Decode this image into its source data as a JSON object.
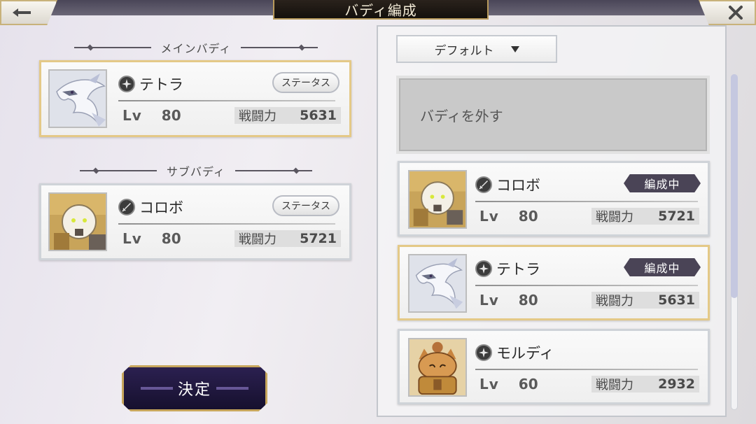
{
  "header": {
    "title": "バディ編成",
    "back_icon": "back-arrow-icon",
    "close_icon": "close-icon"
  },
  "left": {
    "main_section": "メインバディ",
    "sub_section": "サブバディ",
    "main_buddy": {
      "name": "テトラ",
      "element_icon": "star-element-icon",
      "lv_label": "Lv",
      "level": "80",
      "power_label": "戦闘力",
      "power": "5631",
      "status_label": "ステータス"
    },
    "sub_buddy": {
      "name": "コロボ",
      "element_icon": "sword-element-icon",
      "lv_label": "Lv",
      "level": "80",
      "power_label": "戦闘力",
      "power": "5721",
      "status_label": "ステータス"
    },
    "confirm_label": "決定"
  },
  "right": {
    "sort_label": "デフォルト",
    "remove_label": "バディを外す",
    "list": [
      {
        "name": "コロボ",
        "element_icon": "sword-element-icon",
        "lv_label": "Lv",
        "level": "80",
        "power_label": "戦闘力",
        "power": "5721",
        "badge": "編成中"
      },
      {
        "name": "テトラ",
        "element_icon": "star-element-icon",
        "lv_label": "Lv",
        "level": "80",
        "power_label": "戦闘力",
        "power": "5631",
        "badge": "編成中"
      },
      {
        "name": "モルディ",
        "element_icon": "star-element-icon",
        "lv_label": "Lv",
        "level": "60",
        "power_label": "戦闘力",
        "power": "2932"
      }
    ]
  },
  "colors": {
    "gold_border": "#e4c987",
    "badge_bg": "#4a4456",
    "title_bg": "#1c1612",
    "confirm_bg": "#211842"
  }
}
